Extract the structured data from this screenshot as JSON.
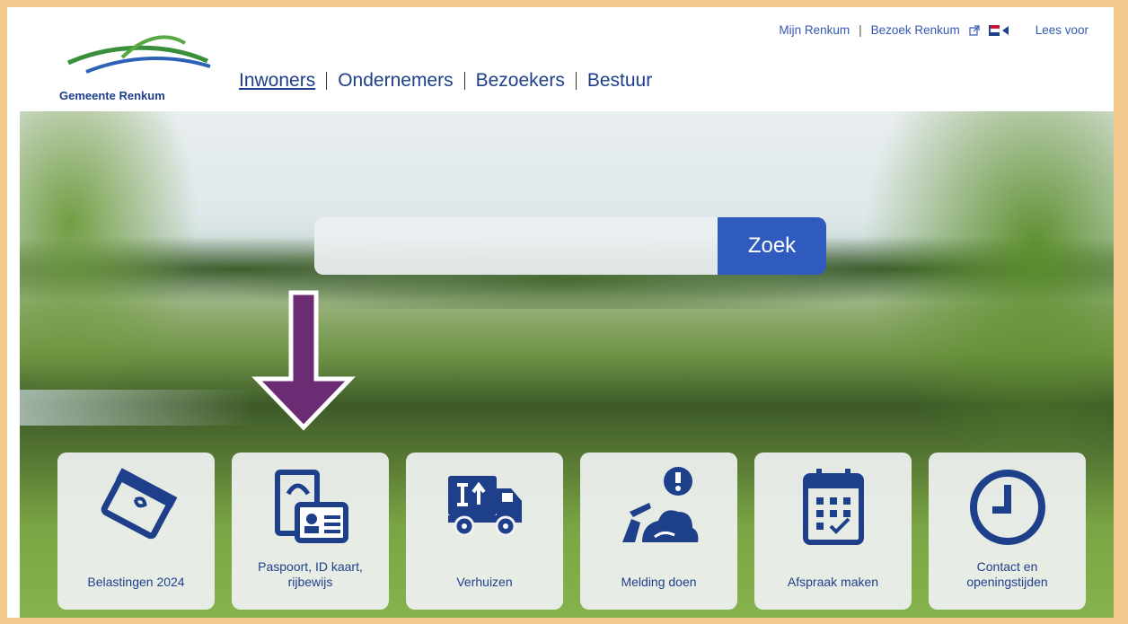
{
  "header": {
    "logo_text": "Gemeente Renkum",
    "top_links": [
      "Mijn Renkum",
      "Bezoek Renkum"
    ],
    "lees_voor": "Lees voor",
    "nav": [
      "Inwoners",
      "Ondernemers",
      "Bezoekers",
      "Bestuur"
    ]
  },
  "search": {
    "placeholder": "",
    "button": "Zoek"
  },
  "tiles": [
    {
      "label": "Belastingen 2024",
      "icon": "tax-card-icon"
    },
    {
      "label": "Paspoort, ID kaart, rijbewijs",
      "icon": "passport-id-icon"
    },
    {
      "label": "Verhuizen",
      "icon": "moving-truck-icon"
    },
    {
      "label": "Melding doen",
      "icon": "report-issue-icon"
    },
    {
      "label": "Afspraak maken",
      "icon": "calendar-icon"
    },
    {
      "label": "Contact en openingstijden",
      "icon": "clock-icon"
    }
  ],
  "colors": {
    "brand": "#1e3f8a",
    "button": "#2e5bbd",
    "arrow": "#6b2c73",
    "frame": "#f3c98f"
  }
}
